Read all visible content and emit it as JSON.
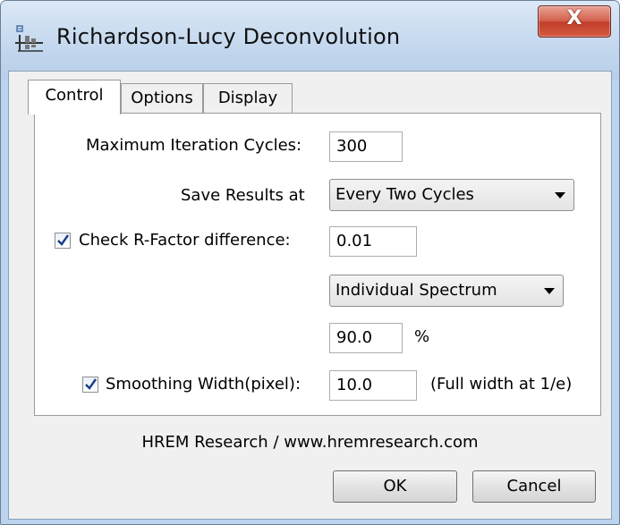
{
  "window": {
    "title": "Richardson-Lucy Deconvolution",
    "close_label": "X"
  },
  "tabs": [
    {
      "label": "Control"
    },
    {
      "label": "Options"
    },
    {
      "label": "Display"
    }
  ],
  "control": {
    "max_iter_label": "Maximum Iteration Cycles:",
    "max_iter_value": "300",
    "save_results_label": "Save Results at",
    "save_results_value": "Every Two Cycles",
    "rfactor_label": "Check R-Factor difference:",
    "rfactor_checked": true,
    "rfactor_value": "0.01",
    "spectrum_value": "Individual Spectrum",
    "percent_value": "90.0",
    "percent_unit": "%",
    "smoothing_label": "Smoothing Width(pixel):",
    "smoothing_checked": true,
    "smoothing_value": "10.0",
    "smoothing_note": "(Full width at 1/e)"
  },
  "footer": {
    "credit": "HREM Research / www.hremresearch.com",
    "ok_label": "OK",
    "cancel_label": "Cancel"
  },
  "icons": {
    "app": "deconvolution-app-icon",
    "close": "close-icon",
    "dropdown": "chevron-down-icon",
    "check": "checkmark-icon"
  }
}
